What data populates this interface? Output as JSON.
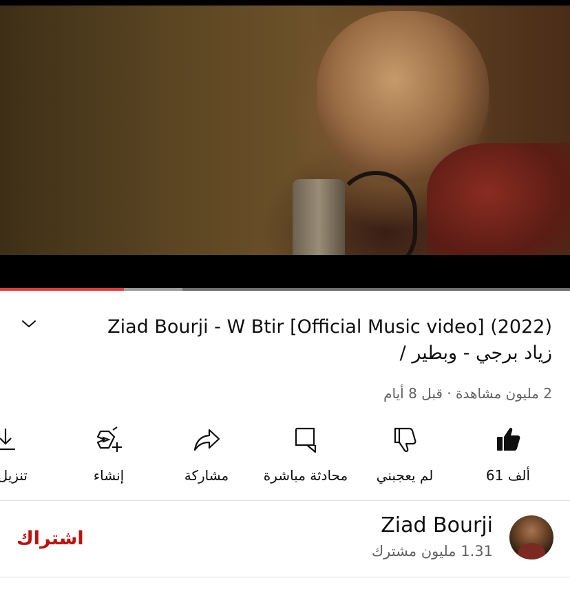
{
  "player": {
    "progress_played": 0.217,
    "progress_buffered": 0.32
  },
  "video": {
    "title_line1": "Ziad Bourji - W Btir [Official Music video] (2022)",
    "title_line2": "زياد برجي - وبطير /",
    "meta": "2 مليون مشاهدة · قبل 8 أيام"
  },
  "actions": {
    "like_label": "61 ألف",
    "dislike_label": "لم يعجبني",
    "live_chat_label": "محادثة مباشرة",
    "share_label": "مشاركة",
    "create_label": "إنشاء",
    "download_label": "تنزيل"
  },
  "channel": {
    "name": "Ziad Bourji",
    "subscribers": "1.31 مليون مشترك",
    "subscribe_label": "اشتراك"
  },
  "colors": {
    "accent_red": "#e53935",
    "subscribe_red": "#c00f0c"
  },
  "icons": [
    "chevron-down-icon",
    "like-icon",
    "dislike-icon",
    "live-chat-icon",
    "share-icon",
    "create-icon",
    "download-icon"
  ]
}
